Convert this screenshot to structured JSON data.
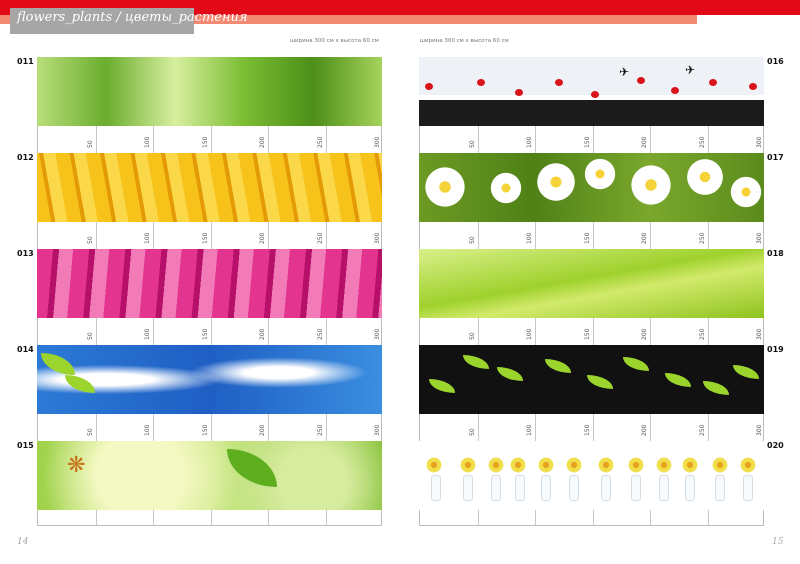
{
  "header": {
    "title": "flowers_plants / цветы_растения",
    "dimension_left": "ширина 300 см х высота 60 см",
    "dimension_right": "ширина 300 см х высота 60 см"
  },
  "scale_labels": [
    "50",
    "100",
    "150",
    "200",
    "250",
    "300"
  ],
  "items_left": [
    {
      "num": "011",
      "theme": "green leaves"
    },
    {
      "num": "012",
      "theme": "yellow petals with dew"
    },
    {
      "num": "013",
      "theme": "pink petals with dew"
    },
    {
      "num": "014",
      "theme": "blue sky with clouds and leaves"
    },
    {
      "num": "015",
      "theme": "green bokeh with butterfly and leaf"
    }
  ],
  "items_right": [
    {
      "num": "016",
      "theme": "red poppies on black grass"
    },
    {
      "num": "017",
      "theme": "white daisies"
    },
    {
      "num": "018",
      "theme": "green leaf with water drops"
    },
    {
      "num": "019",
      "theme": "green leaves on black stones"
    },
    {
      "num": "020",
      "theme": "yellow orchids in glass vases"
    }
  ],
  "pages": {
    "left": "14",
    "right": "15"
  },
  "colors": {
    "accent_red": "#e20a17",
    "accent_salmon": "#f28a73",
    "title_gray": "#a6a6a6"
  }
}
